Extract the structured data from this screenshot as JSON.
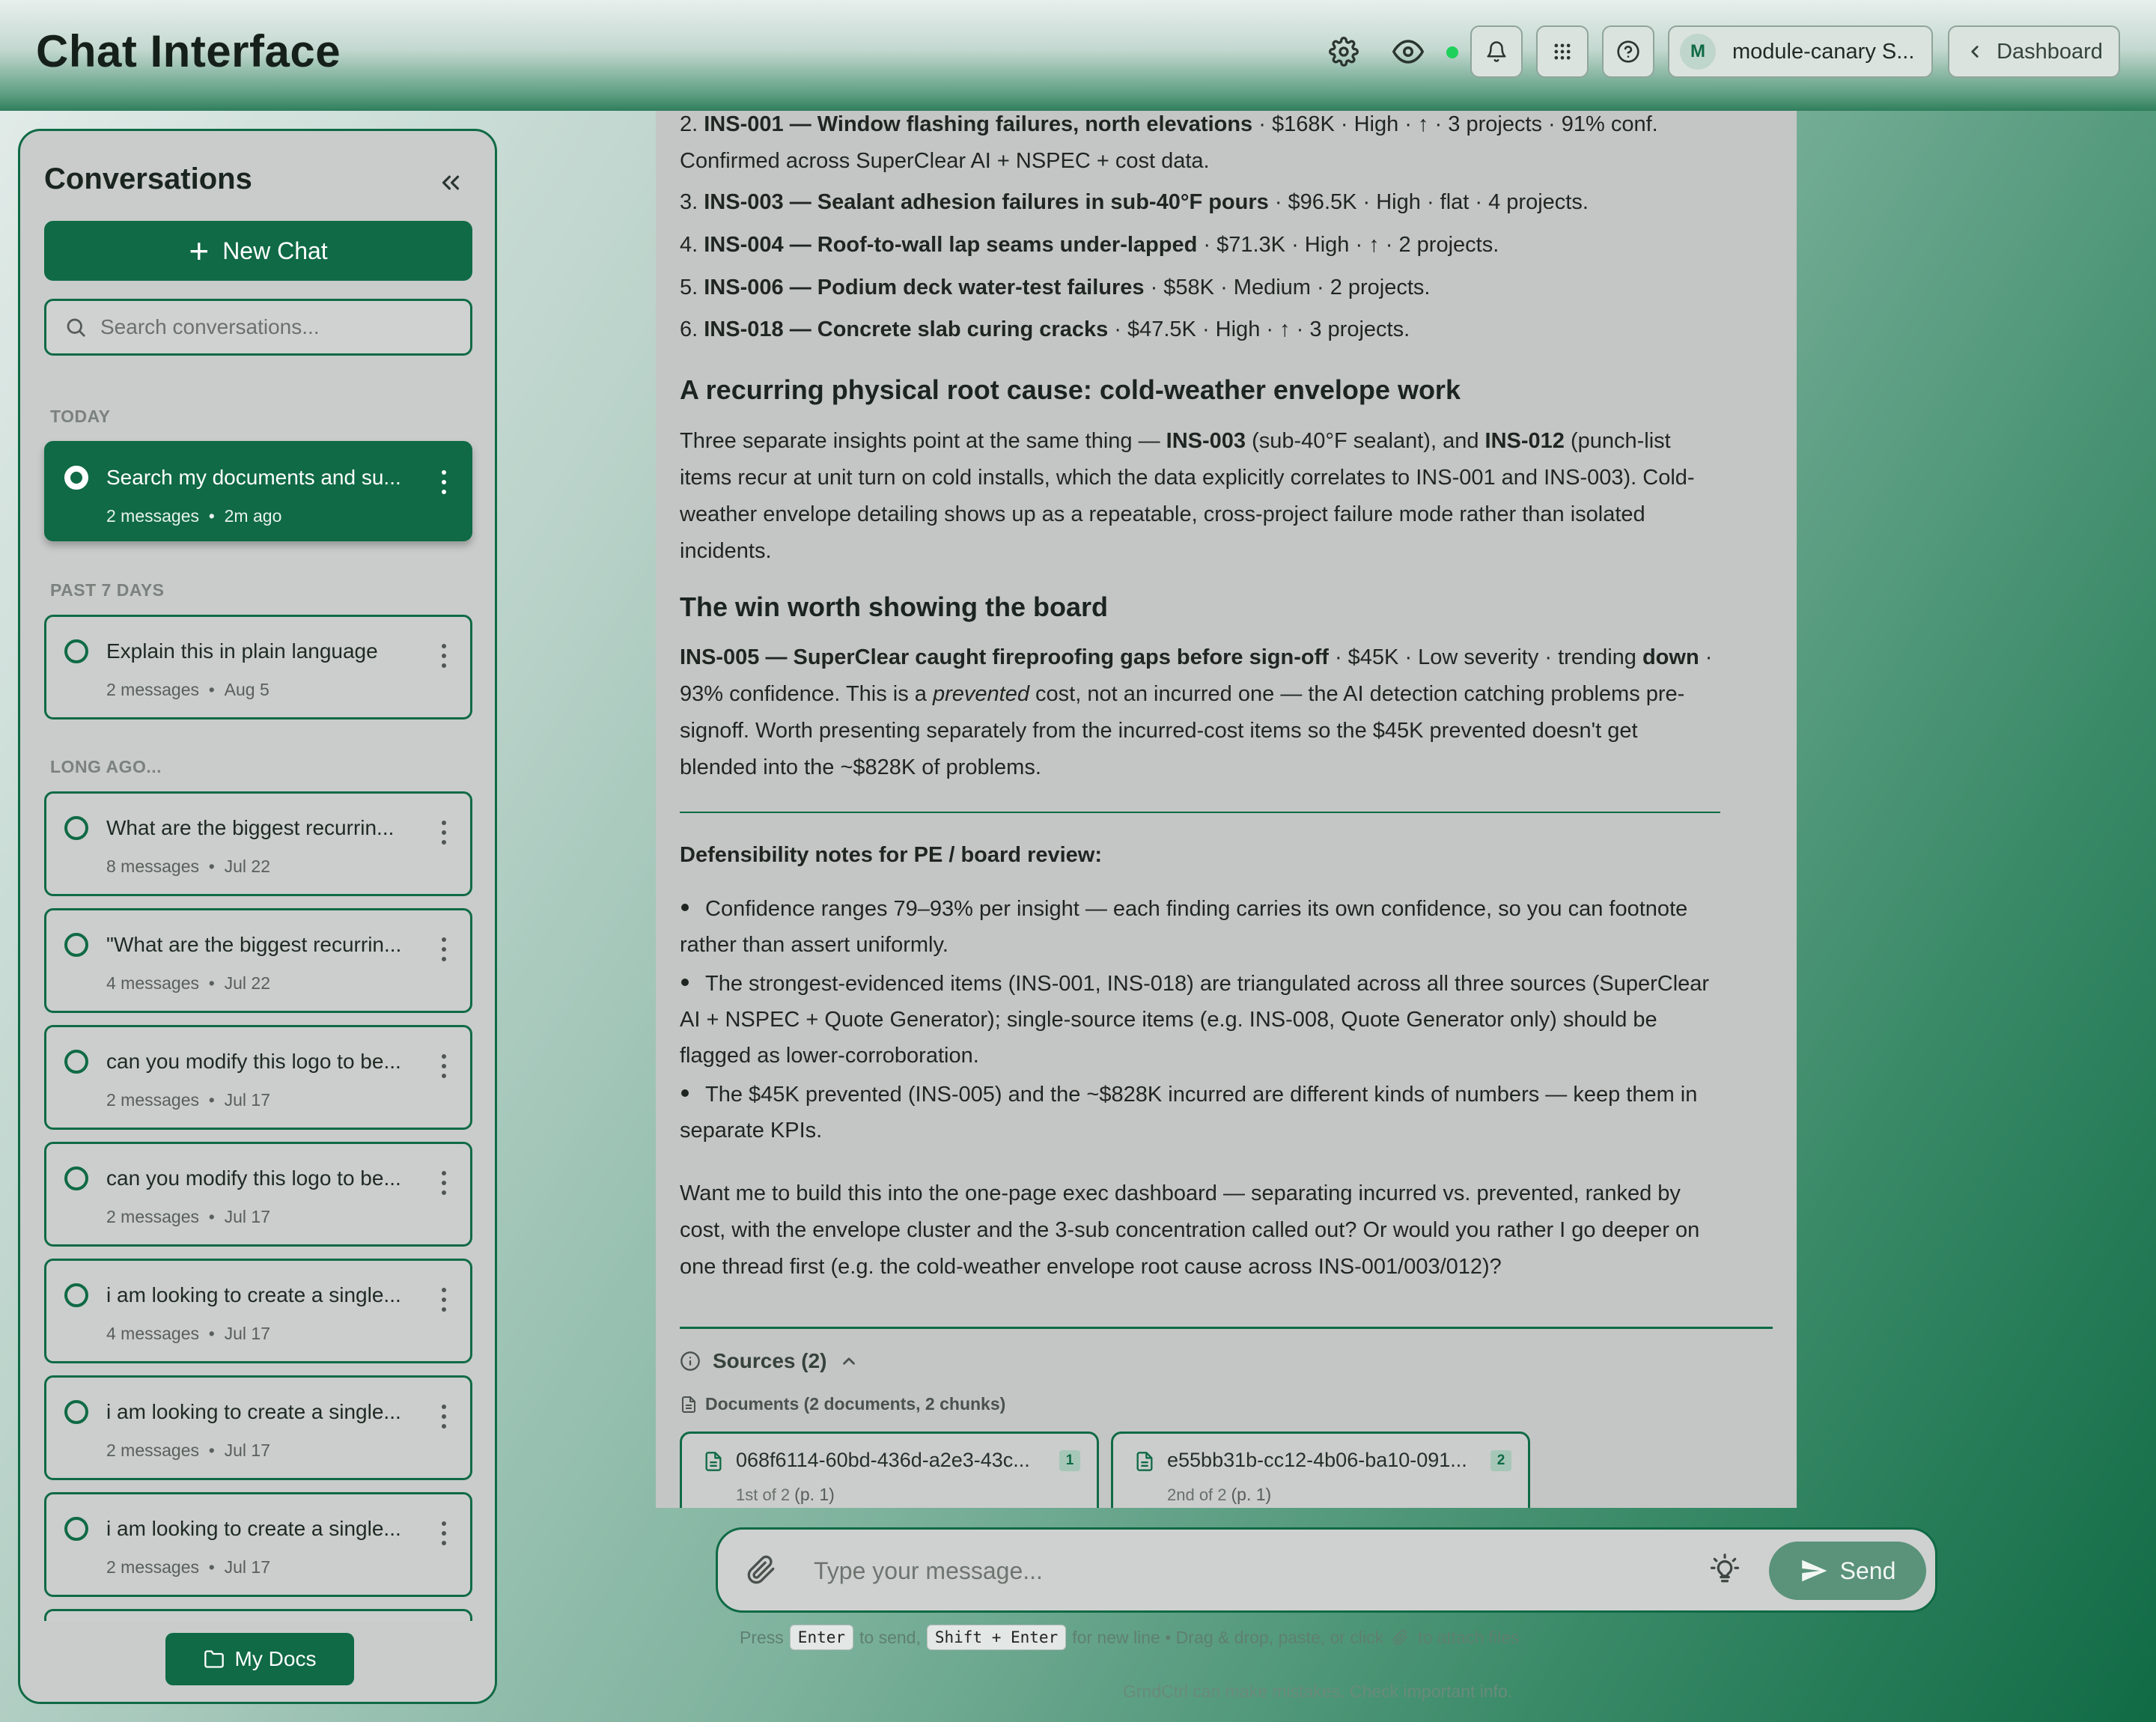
{
  "header": {
    "title": "Chat Interface",
    "icons": [
      "gear-icon",
      "eye-icon",
      "bell-icon",
      "grid-icon",
      "help-icon"
    ],
    "status_color": "#1ed15b",
    "user_initial": "M",
    "user_name": "module-canary S...",
    "dashboard_label": "Dashboard"
  },
  "sidebar": {
    "title": "Conversations",
    "new_chat_label": "New Chat",
    "search_placeholder": "Search conversations...",
    "sections": {
      "today": "TODAY",
      "past7": "PAST 7 DAYS",
      "long_ago": "LONG AGO..."
    },
    "conversations": [
      {
        "title": "Search my documents and su...",
        "messages": "2 messages",
        "time": "2m ago"
      },
      {
        "title": "Explain this in plain language",
        "messages": "2 messages",
        "time": "Aug 5"
      },
      {
        "title": "What are the biggest recurrin...",
        "messages": "8 messages",
        "time": "Jul 22"
      },
      {
        "title": "\"What are the biggest recurrin...",
        "messages": "4 messages",
        "time": "Jul 22"
      },
      {
        "title": "can you modify this logo to be...",
        "messages": "2 messages",
        "time": "Jul 17"
      },
      {
        "title": "can you modify this logo to be...",
        "messages": "2 messages",
        "time": "Jul 17"
      },
      {
        "title": "i am looking to create a single...",
        "messages": "4 messages",
        "time": "Jul 17"
      },
      {
        "title": "i am looking to create a single...",
        "messages": "2 messages",
        "time": "Jul 17"
      },
      {
        "title": "i am looking to create a single...",
        "messages": "2 messages",
        "time": "Jul 17"
      }
    ],
    "my_docs_label": "My Docs"
  },
  "message": {
    "list": [
      {
        "num": "2.",
        "id": "INS-001",
        "title": "Window flashing failures, north elevations",
        "detail": " · $168K · High · ↑ · 3 projects · 91% conf.",
        "extra": "Confirmed across SuperClear AI + NSPEC + cost data."
      },
      {
        "num": "3.",
        "id": "INS-003",
        "title": "Sealant adhesion failures in sub-40°F pours",
        "detail": " · $96.5K · High · flat · 4 projects."
      },
      {
        "num": "4.",
        "id": "INS-004",
        "title": "Roof-to-wall lap seams under-lapped",
        "detail": " · $71.3K · High · ↑ · 2 projects."
      },
      {
        "num": "5.",
        "id": "INS-006",
        "title": "Podium deck water-test failures",
        "detail": " · $58K · Medium · 2 projects."
      },
      {
        "num": "6.",
        "id": "INS-018",
        "title": "Concrete slab curing cracks",
        "detail": " · $47.5K · High · ↑ · 3 projects."
      }
    ],
    "dash": " — ",
    "heading_1": "A recurring physical root cause: cold-weather envelope work",
    "para_1": {
      "a": "Three separate insights point at the same thing — ",
      "b": "INS-003",
      "c": " (sub-40°F sealant), and ",
      "d": "INS-012",
      "e": " (punch-list items recur at unit turn on cold installs, which the data explicitly correlates to INS-001 and INS-003). Cold-weather envelope detailing shows up as a repeatable, cross-project failure mode rather than isolated incidents."
    },
    "heading_2": "The win worth showing the board",
    "para_2": {
      "a": "INS-005 — SuperClear caught fireproofing gaps before sign-off",
      "b": " · $45K · Low severity · trending ",
      "c": "down",
      "d": " · 93% confidence. This is a ",
      "e": "prevented",
      "f": " cost, not an incurred one — the AI detection catching problems pre-signoff. Worth presenting separately from the incurred-cost items so the $45K prevented doesn't get blended into the ~$828K of problems."
    },
    "defensibility_heading": "Defensibility notes for PE / board review:",
    "bullets": [
      "Confidence ranges 79–93% per insight — each finding carries its own confidence, so you can footnote rather than assert uniformly.",
      "The strongest-evidenced items (INS-001, INS-018) are triangulated across all three sources (SuperClear AI + NSPEC + Quote Generator); single-source items (e.g. INS-008, Quote Generator only) should be flagged as lower-corroboration.",
      "The $45K prevented (INS-005) and the ~$828K incurred are different kinds of numbers — keep them in separate KPIs."
    ],
    "closing": "Want me to build this into the one-page exec dashboard — separating incurred vs. prevented, ranked by cost, with the envelope cluster and the 3-sub concentration called out? Or would you rather I go deeper on one thread first (e.g. the cold-weather envelope root cause across INS-001/003/012)?"
  },
  "sources": {
    "label": "Sources (2)",
    "documents_label": "Documents (2 documents, 2 chunks)",
    "docs": [
      {
        "name": "068f6114-60bd-436d-a2e3-43c...",
        "badge": "1",
        "order": "1st of 2",
        "page": "(p. 1)"
      },
      {
        "name": "e55bb31b-cc12-4b06-ba10-091...",
        "badge": "2",
        "order": "2nd of 2",
        "page": "(p. 1)"
      }
    ]
  },
  "composer": {
    "placeholder": "Type your message...",
    "send_label": "Send",
    "hint": {
      "press": "Press",
      "enter_key": "Enter",
      "to_send": "to send,",
      "shift_key": "Shift + Enter",
      "rest": "for new line • Drag & drop, paste, or click",
      "attach": "to attach files"
    },
    "disclaimer": "GrndCtrl can make mistakes. Check important info."
  },
  "colors": {
    "brand": "#0f6a45",
    "send": "#5a927a"
  }
}
